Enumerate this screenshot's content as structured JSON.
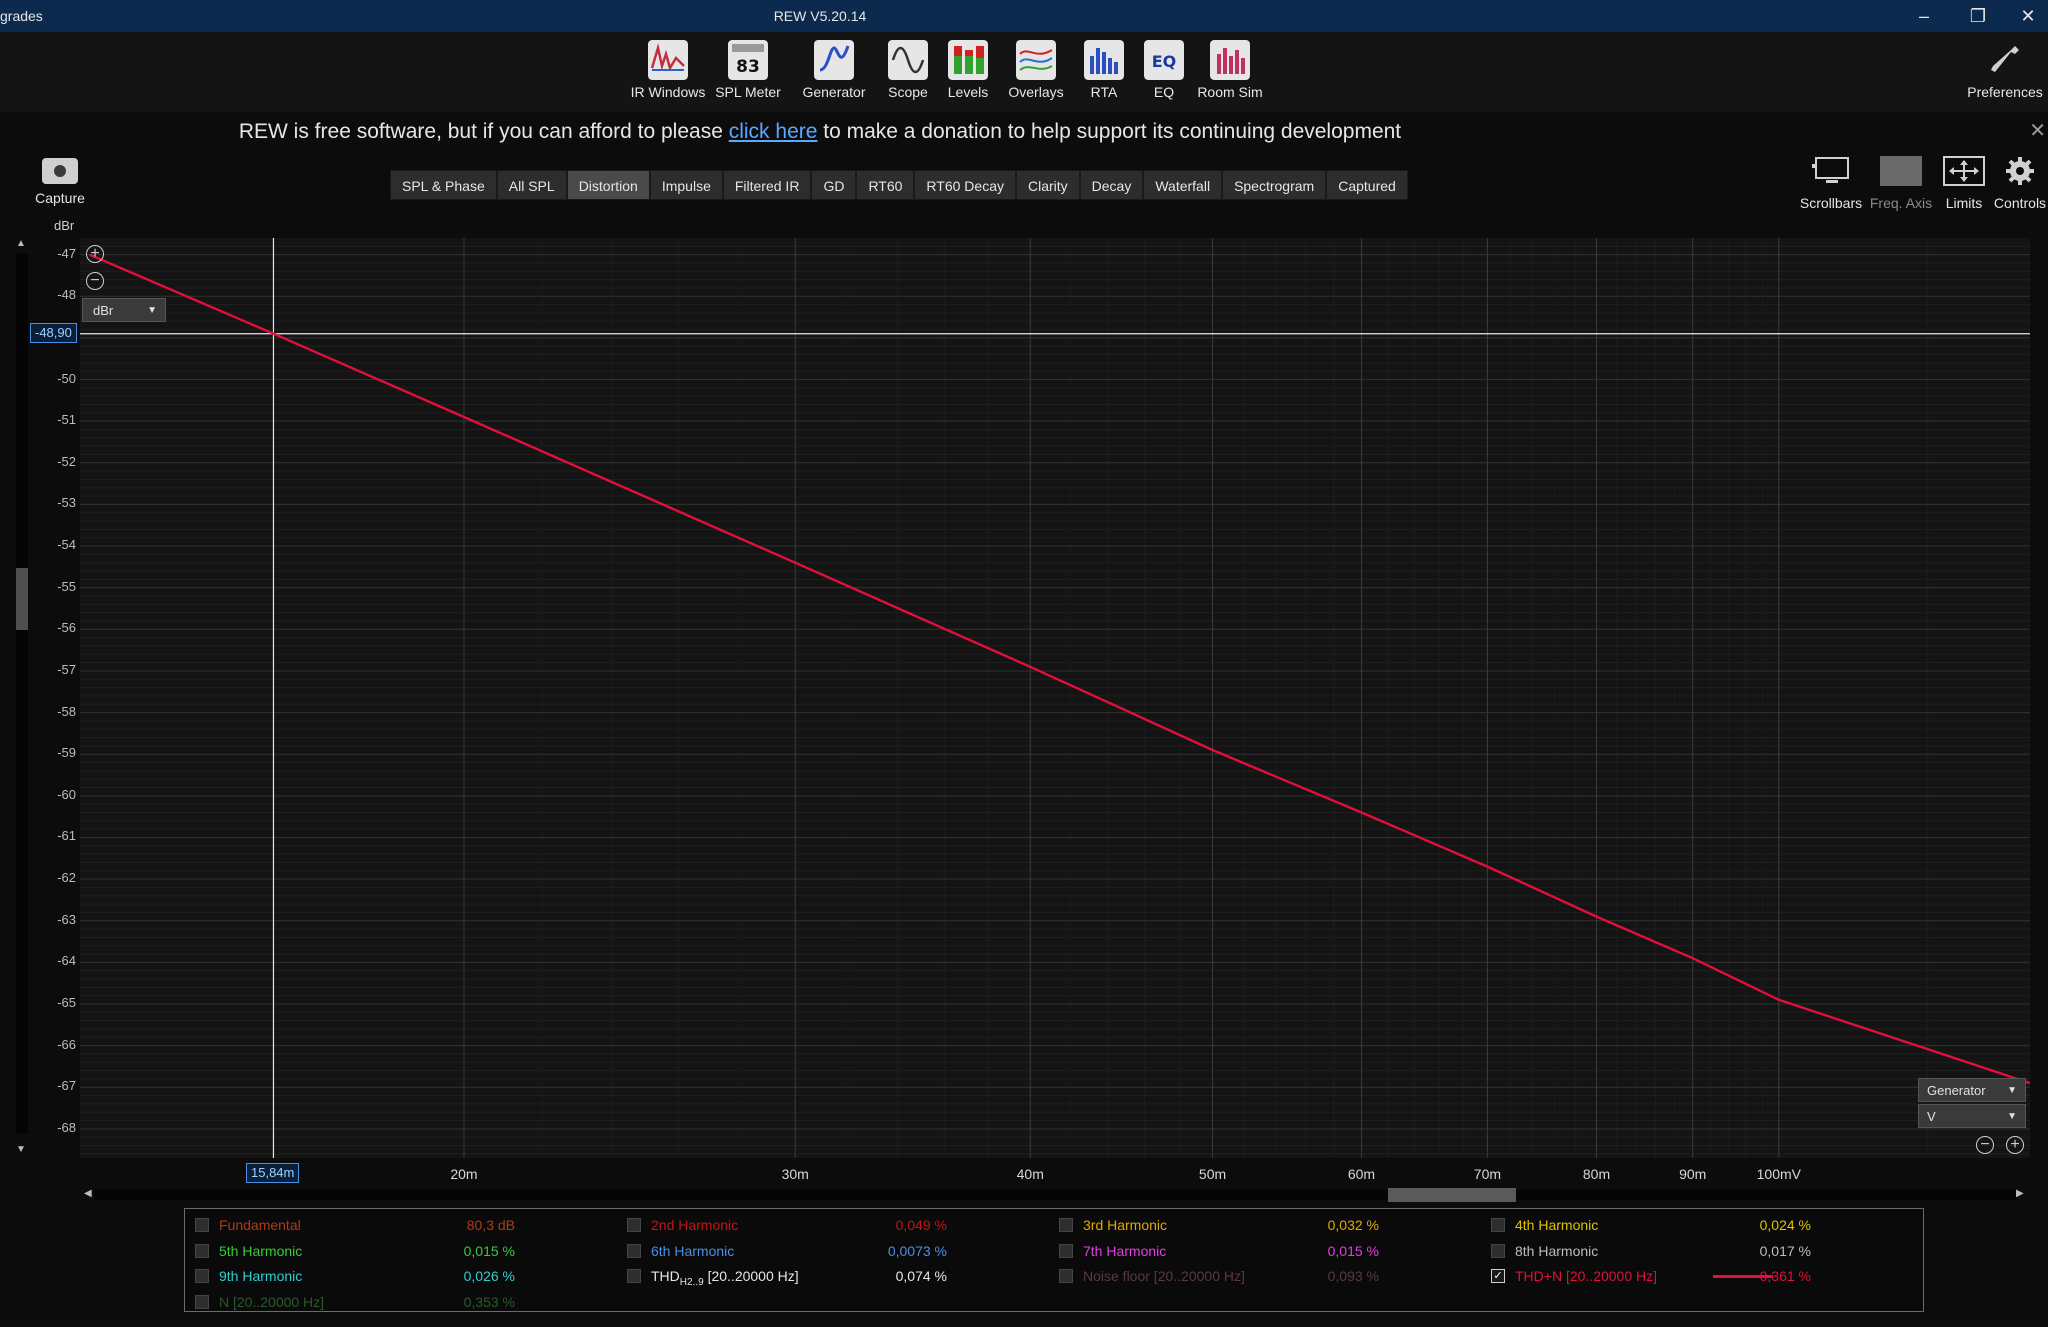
{
  "titlebar": {
    "left_fragment": "grades",
    "title": "REW V5.20.14",
    "minimize": "–",
    "restore": "❐",
    "close": "✕"
  },
  "toolbar": {
    "items": [
      {
        "label": "IR Windows",
        "icon": "ir-windows-icon"
      },
      {
        "label": "SPL Meter",
        "icon": "spl-meter-icon",
        "badge": "83"
      },
      {
        "label": "Generator",
        "icon": "generator-icon"
      },
      {
        "label": "Scope",
        "icon": "scope-icon"
      },
      {
        "label": "Levels",
        "icon": "levels-icon"
      },
      {
        "label": "Overlays",
        "icon": "overlays-icon"
      },
      {
        "label": "RTA",
        "icon": "rta-icon"
      },
      {
        "label": "EQ",
        "icon": "eq-icon"
      },
      {
        "label": "Room Sim",
        "icon": "room-sim-icon"
      }
    ],
    "preferences": "Preferences"
  },
  "donate": {
    "before": "REW is free software, but if you can afford to please ",
    "link": "click here",
    "after": " to make a donation to help support its continuing development"
  },
  "capture": {
    "label": "Capture"
  },
  "tabs": [
    {
      "label": "SPL & Phase",
      "active": false
    },
    {
      "label": "All SPL",
      "active": false
    },
    {
      "label": "Distortion",
      "active": true
    },
    {
      "label": "Impulse",
      "active": false
    },
    {
      "label": "Filtered IR",
      "active": false
    },
    {
      "label": "GD",
      "active": false
    },
    {
      "label": "RT60",
      "active": false
    },
    {
      "label": "RT60 Decay",
      "active": false
    },
    {
      "label": "Clarity",
      "active": false
    },
    {
      "label": "Decay",
      "active": false
    },
    {
      "label": "Waterfall",
      "active": false
    },
    {
      "label": "Spectrogram",
      "active": false
    },
    {
      "label": "Captured",
      "active": false
    }
  ],
  "right_tools": {
    "scrollbars": "Scrollbars",
    "freq_axis": "Freq. Axis",
    "limits": "Limits",
    "controls": "Controls"
  },
  "graph": {
    "y_unit": "dBr",
    "unit_select": "dBr",
    "cursor_y": "-48,90",
    "cursor_x": "15,84m",
    "generator_select": "Generator",
    "generator_unit": "V"
  },
  "chart_data": {
    "type": "line",
    "x_scale": "log",
    "xlim": [
      0.0125,
      0.136
    ],
    "ylim": [
      -68.7,
      -46.6
    ],
    "ylabel": "dBr",
    "x_ticks": [
      {
        "v": 0.02,
        "label": "20m"
      },
      {
        "v": 0.03,
        "label": "30m"
      },
      {
        "v": 0.04,
        "label": "40m"
      },
      {
        "v": 0.05,
        "label": "50m"
      },
      {
        "v": 0.06,
        "label": "60m"
      },
      {
        "v": 0.07,
        "label": "70m"
      },
      {
        "v": 0.08,
        "label": "80m"
      },
      {
        "v": 0.09,
        "label": "90m"
      },
      {
        "v": 0.1,
        "label": "100mV"
      }
    ],
    "y_ticks": [
      -47,
      -48,
      -50,
      -51,
      -52,
      -53,
      -54,
      -55,
      -56,
      -57,
      -58,
      -59,
      -60,
      -61,
      -62,
      -63,
      -64,
      -65,
      -66,
      -67,
      -68
    ],
    "series": [
      {
        "name": "THD+N [20..20000 Hz]",
        "color": "#e0103a",
        "points": [
          [
            0.01265,
            -47.0
          ],
          [
            0.01584,
            -48.9
          ],
          [
            0.02,
            -50.9
          ],
          [
            0.03,
            -54.4
          ],
          [
            0.04,
            -56.9
          ],
          [
            0.05,
            -58.9
          ],
          [
            0.06,
            -60.4
          ],
          [
            0.07,
            -61.7
          ],
          [
            0.08,
            -62.9
          ],
          [
            0.09,
            -63.9
          ],
          [
            0.1,
            -64.9
          ],
          [
            0.136,
            -66.9
          ]
        ]
      }
    ],
    "cursor": {
      "x": 0.01584,
      "y": -48.9
    }
  },
  "legend": {
    "rows": [
      [
        {
          "name": "Fundamental",
          "value": "80,3 dB",
          "color": "#b03a14",
          "checked": false
        },
        {
          "name": "2nd Harmonic",
          "value": "0,049 %",
          "color": "#c41414",
          "checked": false
        },
        {
          "name": "3rd Harmonic",
          "value": "0,032 %",
          "color": "#e2a800",
          "checked": false
        },
        {
          "name": "4th Harmonic",
          "value": "0,024 %",
          "color": "#e2c200",
          "checked": false
        }
      ],
      [
        {
          "name": "5th Harmonic",
          "value": "0,015 %",
          "color": "#3cc83c",
          "checked": false
        },
        {
          "name": "6th Harmonic",
          "value": "0,0073 %",
          "color": "#4a90e2",
          "checked": false
        },
        {
          "name": "7th Harmonic",
          "value": "0,015 %",
          "color": "#e040e0",
          "checked": false
        },
        {
          "name": "8th Harmonic",
          "value": "0,017 %",
          "color": "#bdbdbd",
          "checked": false
        }
      ],
      [
        {
          "name": "9th Harmonic",
          "value": "0,026 %",
          "color": "#30d0d0",
          "checked": false
        },
        {
          "name": "THD",
          "sub": "H2..9",
          "suffix": " [20..20000 Hz]",
          "value": "0,074 %",
          "color": "#e6e6e6",
          "checked": false
        },
        {
          "name": "Noise floor [20..20000 Hz]",
          "value": "0,093 %",
          "color": "#5a3a3a",
          "checked": false
        },
        {
          "name": "THD+N [20..20000 Hz]",
          "value": "0,361 %",
          "color": "#e0103a",
          "checked": true,
          "swatch": true
        }
      ],
      [
        {
          "name": "N [20..20000 Hz]",
          "value": "0,353 %",
          "color": "#2a5a2a",
          "checked": false
        }
      ]
    ]
  },
  "colors": {
    "titlebar": "#0b2a4d",
    "background": "#0c0c0c",
    "plot": "#141414",
    "trace": "#e0103a",
    "link": "#5aa8ff"
  }
}
